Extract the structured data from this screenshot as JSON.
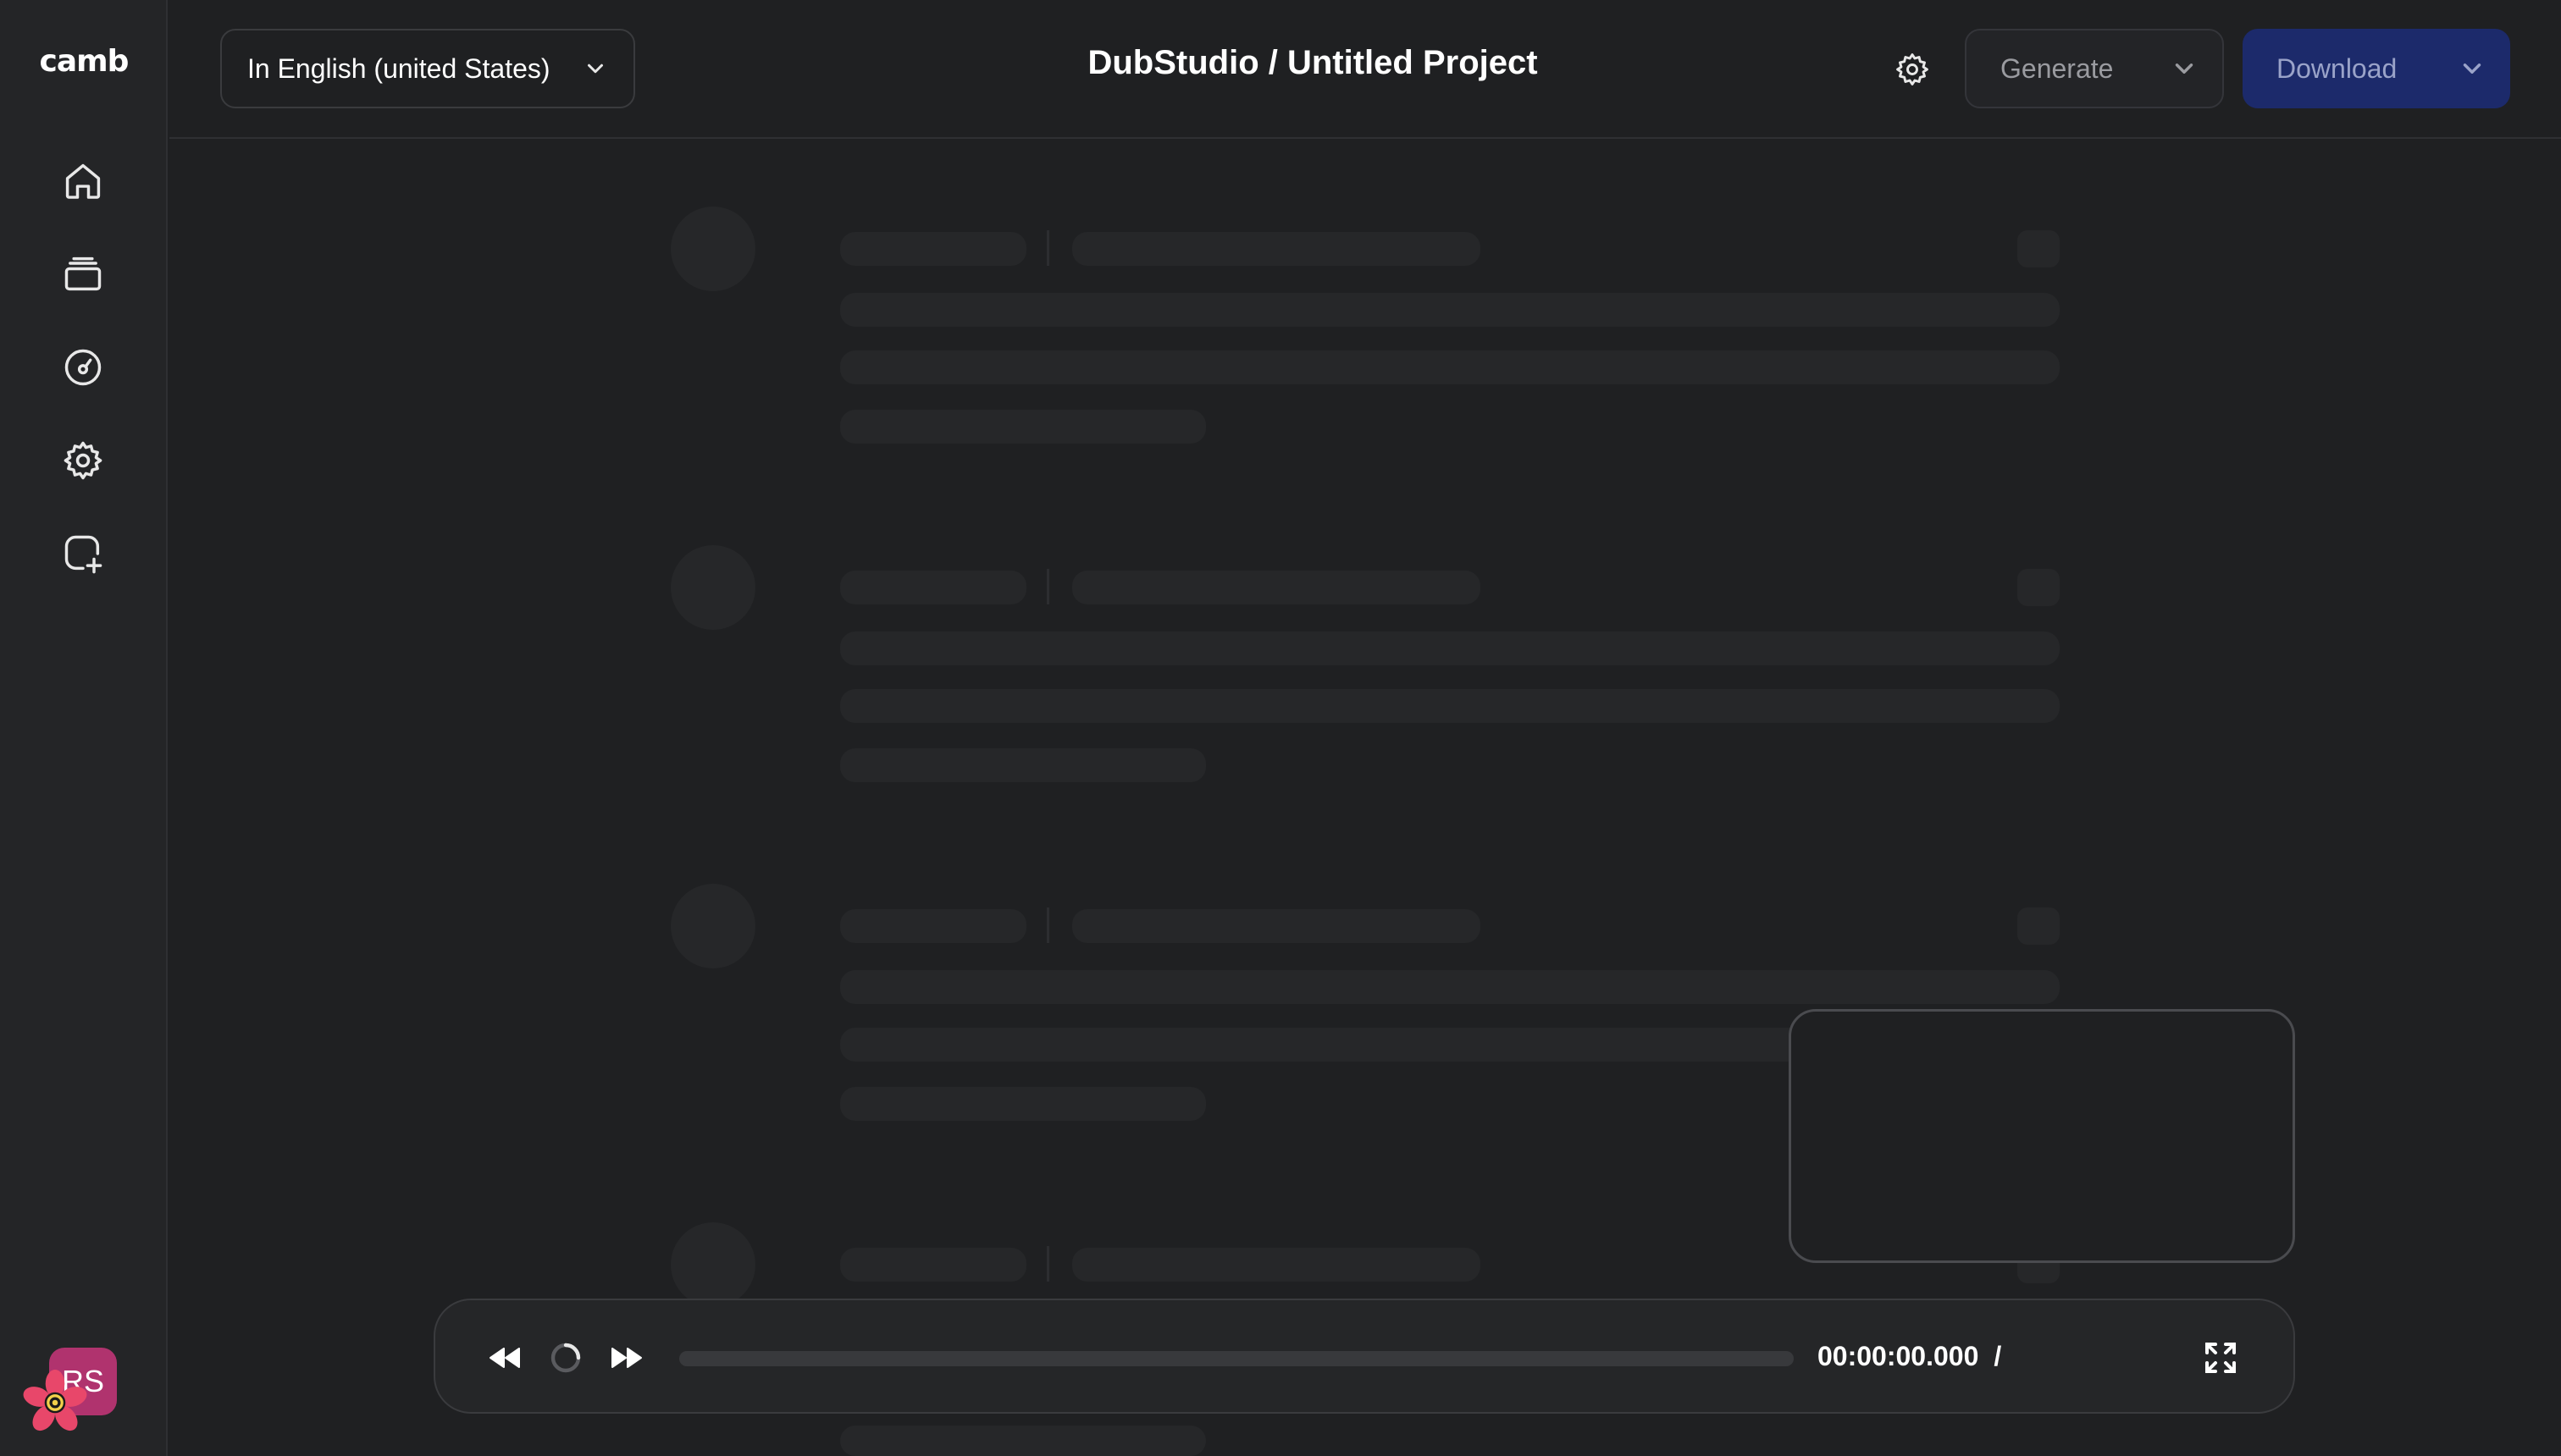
{
  "sidebar": {
    "logo": "camb",
    "nav_items": [
      {
        "icon": "home-icon"
      },
      {
        "icon": "layers-icon"
      },
      {
        "icon": "gauge-icon"
      },
      {
        "icon": "gear-icon"
      },
      {
        "icon": "add-chat-icon"
      }
    ],
    "avatar_initials": "RS",
    "avatar_color": "#b0336e"
  },
  "header": {
    "language_select": "In English (united States)",
    "title": "DubStudio / Untitled Project",
    "generate_label": "Generate",
    "download_label": "Download",
    "download_color": "#1c2a6b"
  },
  "player": {
    "time": "00:00:00.000",
    "separator": "/",
    "progress": 0
  },
  "colors": {
    "background": "#1f2022",
    "sidebar": "#242527",
    "skeleton": "#262729"
  }
}
